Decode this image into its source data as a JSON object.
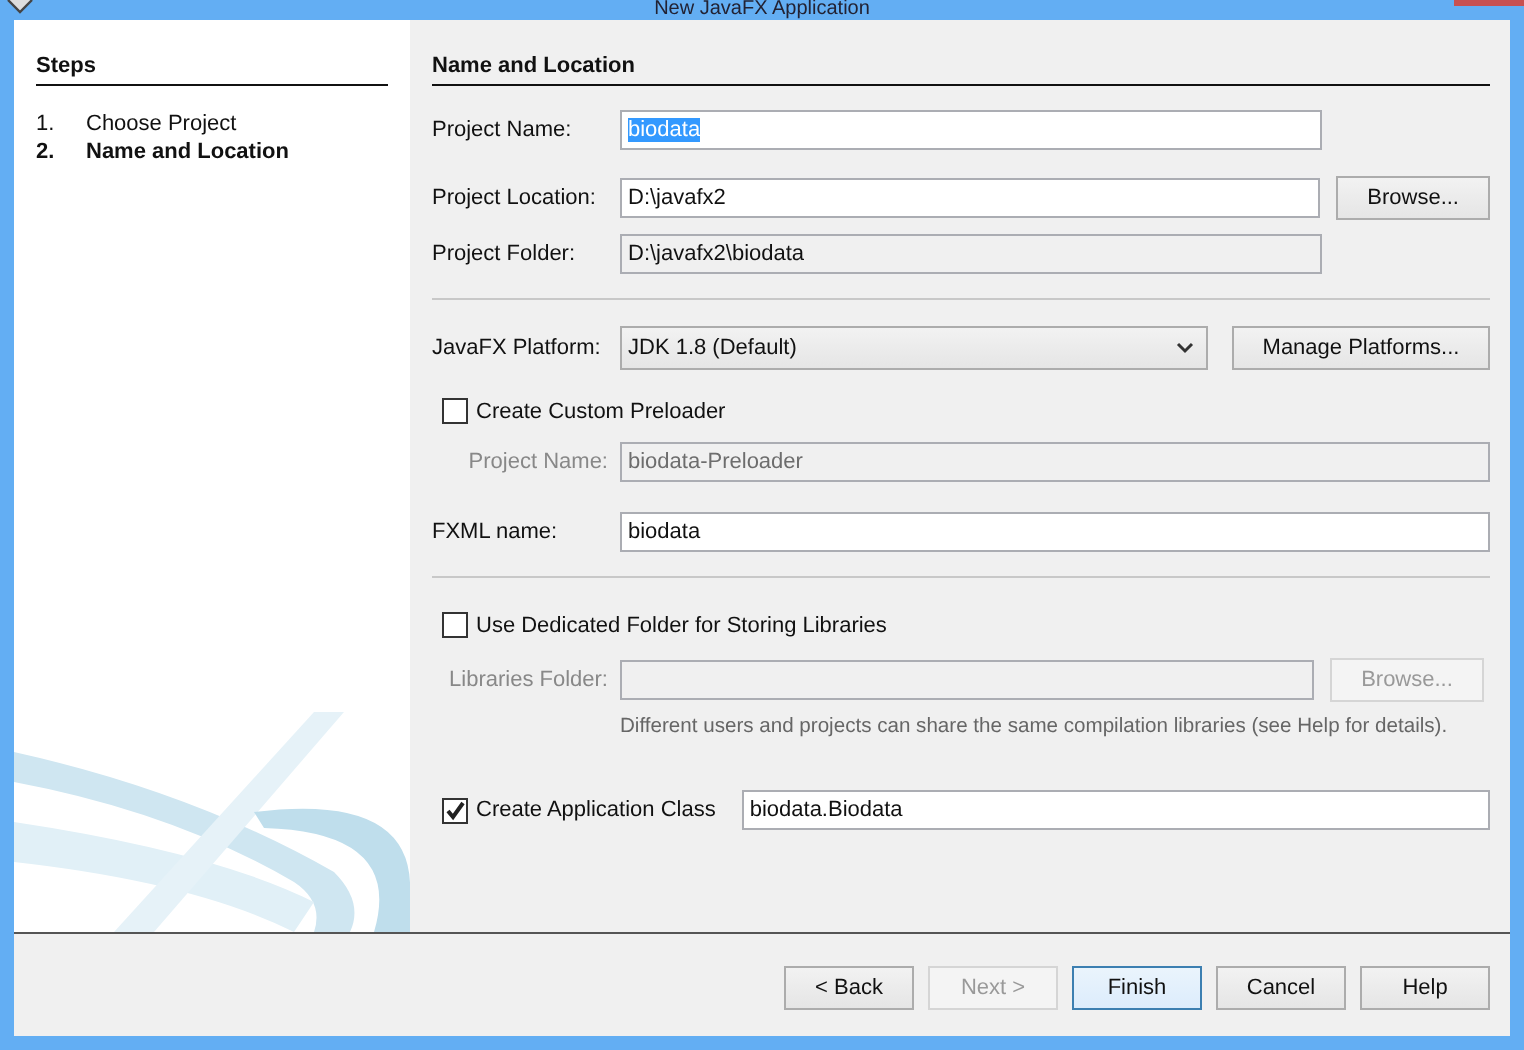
{
  "window": {
    "title": "New JavaFX Application"
  },
  "steps": {
    "title": "Steps",
    "items": [
      {
        "number": "1.",
        "label": "Choose Project",
        "selected": false
      },
      {
        "number": "2.",
        "label": "Name and Location",
        "selected": true
      }
    ]
  },
  "panel": {
    "title": "Name and Location"
  },
  "project_name": {
    "label": "Project Name:",
    "value": "biodata",
    "text_selected": true
  },
  "project_location": {
    "label": "Project Location:",
    "value": "D:\\javafx2",
    "button": "Browse..."
  },
  "project_folder": {
    "label": "Project Folder:",
    "value": "D:\\javafx2\\biodata",
    "readonly": true
  },
  "platform": {
    "label": "JavaFX Platform:",
    "value": "JDK 1.8 (Default)",
    "button": "Manage Platforms..."
  },
  "custom_preloader": {
    "label": "Create Custom Preloader",
    "checked": false
  },
  "preloader_project_name": {
    "label": "Project Name:",
    "value": "biodata-Preloader",
    "disabled": true
  },
  "fxml_name": {
    "label": "FXML name:",
    "value": "biodata"
  },
  "dedicated_folder": {
    "label": "Use Dedicated Folder for Storing Libraries",
    "checked": false
  },
  "libraries_folder": {
    "label": "Libraries Folder:",
    "button": "Browse...",
    "disabled": true
  },
  "libraries_note": "Different users and projects can share the same compilation libraries (see Help for details).",
  "application_class": {
    "label": "Create Application Class",
    "checked": true,
    "value": "biodata.Biodata"
  },
  "buttons": [
    {
      "label": "< Back",
      "disabled": false,
      "default": false
    },
    {
      "label": "Next >",
      "disabled": true,
      "default": false
    },
    {
      "label": "Finish",
      "disabled": false,
      "default": true
    },
    {
      "label": "Cancel",
      "disabled": false,
      "default": false
    },
    {
      "label": "Help",
      "disabled": false,
      "default": false
    }
  ]
}
